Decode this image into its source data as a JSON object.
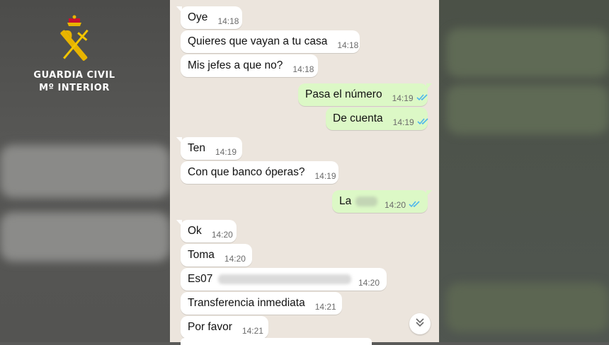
{
  "logo": {
    "line1": "GUARDIA CIVIL",
    "line2": "Mº INTERIOR"
  },
  "messages": [
    {
      "text": "Oye",
      "time": "14:18"
    },
    {
      "text": "Quieres que vayan a tu casa",
      "time": "14:18"
    },
    {
      "text": "Mis jefes a que no?",
      "time": "14:18"
    },
    {
      "text": "Pasa el número",
      "time": "14:19"
    },
    {
      "text": "De cuenta",
      "time": "14:19"
    },
    {
      "text": "Ten",
      "time": "14:19"
    },
    {
      "text": "Con que banco óperas?",
      "time": "14:19"
    },
    {
      "text": "La",
      "time": "14:20"
    },
    {
      "text": "Ok",
      "time": "14:20"
    },
    {
      "text": "Toma",
      "time": "14:20"
    },
    {
      "text": "Es07",
      "time": "14:20"
    },
    {
      "text": "Transferencia inmediata",
      "time": "14:21"
    },
    {
      "text": "Por favor",
      "time": "14:21"
    }
  ],
  "colors": {
    "incoming": "#ffffff",
    "outgoing": "#dcf8c6",
    "chat_background": "#ece5dd",
    "read_ticks": "#4fb6ec"
  },
  "icons": {
    "read_receipt": "double-check-icon",
    "scroll_down": "chevron-double-down-icon",
    "emblem": "guardia-civil-emblem"
  }
}
